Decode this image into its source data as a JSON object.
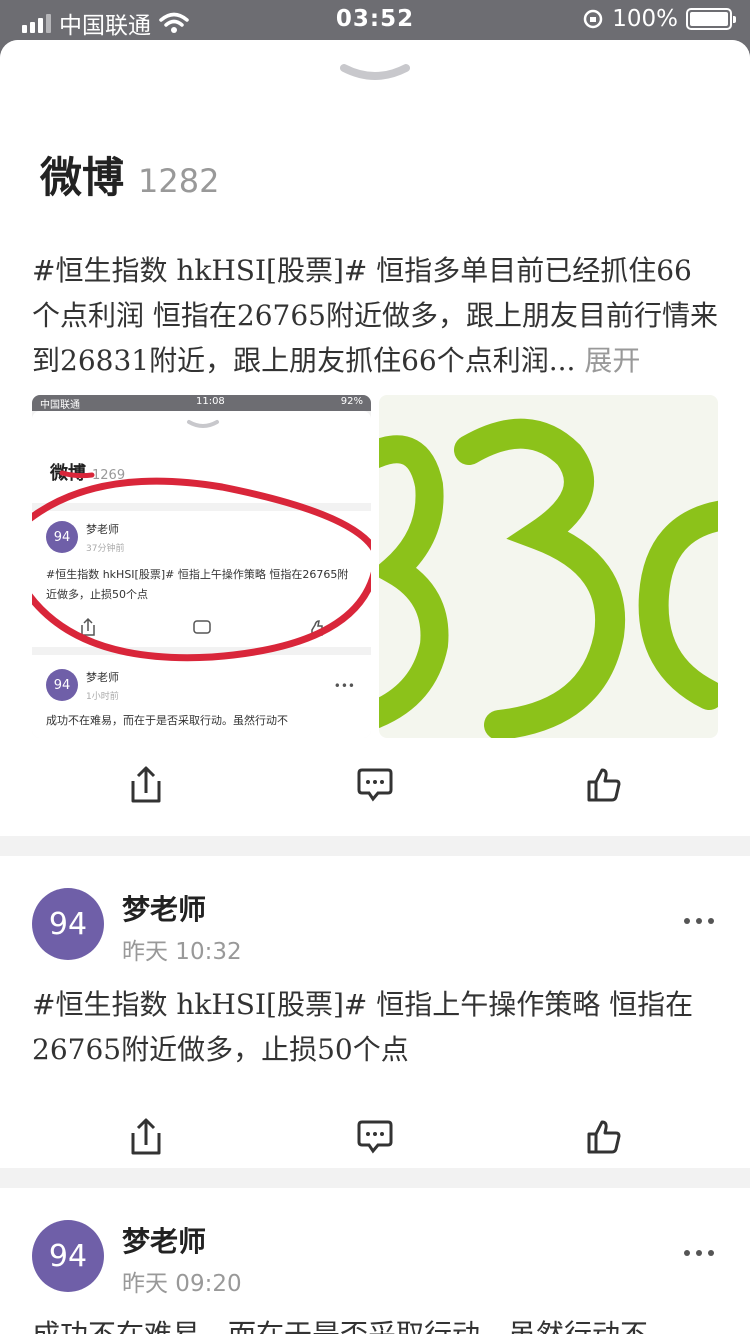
{
  "status_bar": {
    "carrier": "中国联通",
    "time": "03:52",
    "battery": "100%"
  },
  "header": {
    "title": "微博",
    "count": "1282"
  },
  "post1": {
    "text": "#恒生指数 hkHSI[股票]# 恒指多单目前已经抓住66个点利润 恒指在26765附近做多，跟上朋友目前行情来到26831附近，跟上朋友抓住66个点利润...",
    "more": "展开",
    "mini": {
      "carrier": "中国联通",
      "time": "11:08",
      "battery": "92%",
      "title": "微博",
      "count": "1269",
      "post_a": {
        "avatar": "94",
        "name": "梦老师",
        "time": "37分钟前",
        "text": "#恒生指数 hkHSI[股票]# 恒指上午操作策略 恒指在26765附近做多，止损50个点"
      },
      "post_b": {
        "avatar": "94",
        "name": "梦老师",
        "time": "1小时前",
        "text": "成功不在难易，而在于是否采取行动。虽然行动不"
      }
    }
  },
  "post2": {
    "avatar": "94",
    "name": "梦老师",
    "time": "昨天 10:32",
    "text": "#恒生指数 hkHSI[股票]# 恒指上午操作策略 恒指在26765附近做多，止损50个点"
  },
  "post3": {
    "avatar": "94",
    "name": "梦老师",
    "time": "昨天 09:20",
    "text": "成功不在难易，而在于是否采取行动，虽然行动不"
  },
  "colors": {
    "accent_avatar": "#6f5fa8",
    "stroke_red": "#d9263a",
    "stroke_green": "#8cc21a"
  },
  "icons": [
    "share-icon",
    "comment-icon",
    "like-icon",
    "more-icon",
    "chevron-down-icon"
  ]
}
